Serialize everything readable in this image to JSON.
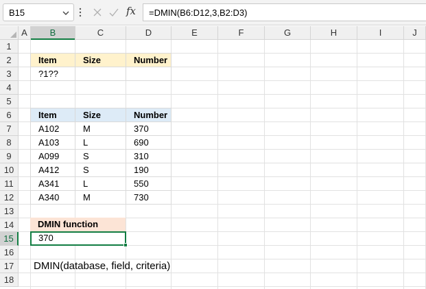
{
  "formula_bar": {
    "name_box": "B15",
    "fx_symbol": "fx",
    "formula": "=DMIN(B6:D12,3,B2:D3)"
  },
  "columns": [
    "A",
    "B",
    "C",
    "D",
    "E",
    "F",
    "G",
    "H",
    "I",
    "J"
  ],
  "rows": [
    "1",
    "2",
    "3",
    "4",
    "5",
    "6",
    "7",
    "8",
    "9",
    "10",
    "11",
    "12",
    "13",
    "14",
    "15",
    "16",
    "17",
    "18"
  ],
  "selected_column": "B",
  "selected_row": "15",
  "criteria_table": {
    "headers": [
      "Item",
      "Size",
      "Number"
    ],
    "row": [
      "?1??",
      "",
      ""
    ]
  },
  "data_table": {
    "headers": [
      "Item",
      "Size",
      "Number"
    ],
    "rows": [
      [
        "A102",
        "M",
        "370"
      ],
      [
        "A103",
        "L",
        "690"
      ],
      [
        "A099",
        "S",
        "310"
      ],
      [
        "A412",
        "S",
        "190"
      ],
      [
        "A341",
        "L",
        "550"
      ],
      [
        "A340",
        "M",
        "730"
      ]
    ]
  },
  "result": {
    "label": "DMIN function",
    "value": "370"
  },
  "syntax_note": "DMIN(database, field, criteria)",
  "colors": {
    "criteria_header": "#fff2cc",
    "data_header": "#ddebf7",
    "result_header": "#fce4d6",
    "selection": "#107c41"
  }
}
